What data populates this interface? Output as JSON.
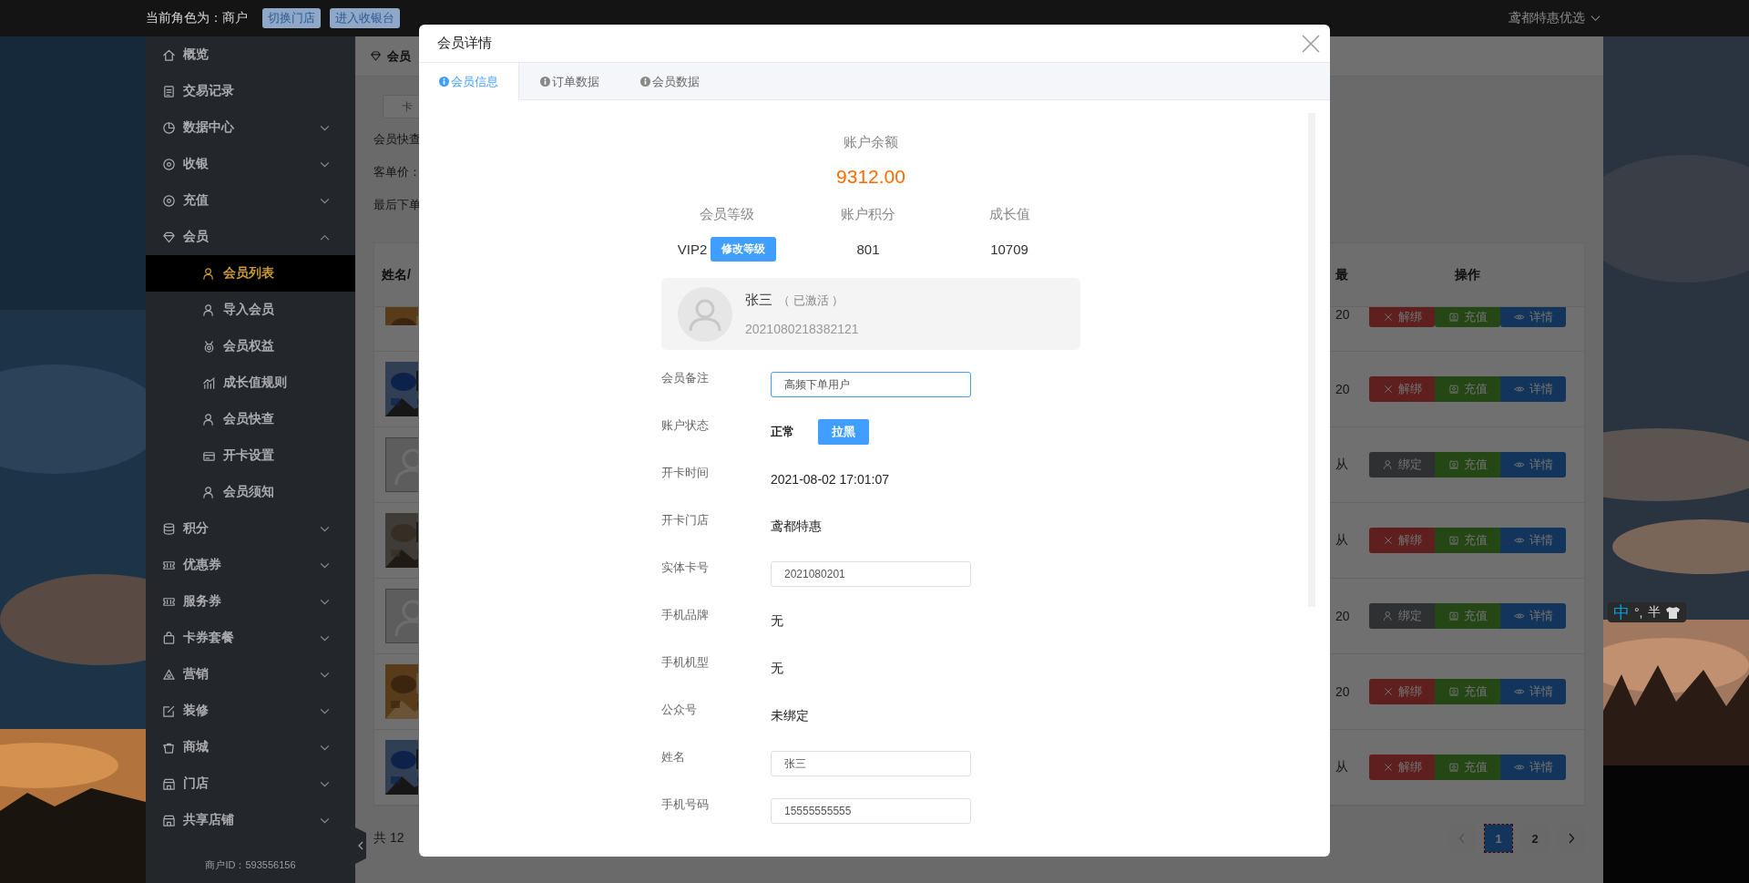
{
  "top_bar": {
    "role": "当前角色为：商户",
    "buttons": [
      {
        "label": "切换门店"
      },
      {
        "label": "进入收银台"
      }
    ],
    "store": "鸢都特惠优选"
  },
  "sidebar": {
    "items": [
      {
        "label": "概览",
        "selected": false
      },
      {
        "label": "交易记录",
        "selected": false
      },
      {
        "label": "数据中心",
        "selected": false,
        "expanded": false
      },
      {
        "label": "收银",
        "selected": false,
        "expanded": false
      },
      {
        "label": "充值",
        "selected": false,
        "expanded": false
      },
      {
        "label": "会员",
        "selected": false,
        "expanded": true,
        "children": [
          {
            "label": "会员列表",
            "selected": true
          },
          {
            "label": "导入会员",
            "selected": false
          },
          {
            "label": "会员权益",
            "selected": false
          },
          {
            "label": "成长值规则",
            "selected": false
          },
          {
            "label": "会员快查",
            "selected": false
          },
          {
            "label": "开卡设置",
            "selected": false
          },
          {
            "label": "会员须知",
            "selected": false
          }
        ]
      },
      {
        "label": "积分",
        "selected": false,
        "expanded": false
      },
      {
        "label": "优惠券",
        "selected": false,
        "expanded": false
      },
      {
        "label": "服务券",
        "selected": false,
        "expanded": false
      },
      {
        "label": "卡券套餐",
        "selected": false,
        "expanded": false
      },
      {
        "label": "营销",
        "selected": false,
        "expanded": false
      },
      {
        "label": "装修",
        "selected": false,
        "expanded": false
      },
      {
        "label": "商城",
        "selected": false,
        "expanded": false
      },
      {
        "label": "门店",
        "selected": false,
        "expanded": false
      },
      {
        "label": "共享店铺",
        "selected": false,
        "expanded": false
      }
    ],
    "merchant_id": "商户ID：593556156"
  },
  "content": {
    "breadcrumb": "会员",
    "search_placeholder": "卡",
    "quick_lookup": "会员快查",
    "avg_order": "客单价：",
    "last_order": "最后下单",
    "table": {
      "columns": [
        {
          "label": "姓名/"
        },
        {
          "label": "最"
        },
        {
          "label": "操作"
        }
      ],
      "rows": [
        {
          "cell": "20",
          "actions": [
            {
              "kind": "unbind",
              "label": "解绑"
            },
            {
              "kind": "recharge",
              "label": "充值"
            },
            {
              "kind": "details",
              "label": "详情"
            }
          ]
        },
        {
          "cell": "20",
          "actions": [
            {
              "kind": "unbind",
              "label": "解绑"
            },
            {
              "kind": "recharge",
              "label": "充值"
            },
            {
              "kind": "details",
              "label": "详情"
            }
          ]
        },
        {
          "avatar": {
            "kind": "placeholder"
          },
          "cell": "从",
          "actions": [
            {
              "kind": "bind",
              "label": "绑定"
            },
            {
              "kind": "recharge",
              "label": "充值"
            },
            {
              "kind": "details",
              "label": "详情"
            }
          ]
        },
        {
          "cell": "从",
          "actions": [
            {
              "kind": "unbind",
              "label": "解绑"
            },
            {
              "kind": "recharge",
              "label": "充值"
            },
            {
              "kind": "details",
              "label": "详情"
            }
          ]
        },
        {
          "avatar": {
            "kind": "placeholder"
          },
          "cell": "20",
          "actions": [
            {
              "kind": "bind",
              "label": "绑定"
            },
            {
              "kind": "recharge",
              "label": "充值"
            },
            {
              "kind": "details",
              "label": "详情"
            }
          ]
        },
        {
          "cell": "20",
          "actions": [
            {
              "kind": "unbind",
              "label": "解绑"
            },
            {
              "kind": "recharge",
              "label": "充值"
            },
            {
              "kind": "details",
              "label": "详情"
            }
          ]
        },
        {
          "cell": "从",
          "actions": [
            {
              "kind": "unbind",
              "label": "解绑"
            },
            {
              "kind": "recharge",
              "label": "充值"
            },
            {
              "kind": "details",
              "label": "详情"
            }
          ]
        }
      ]
    },
    "pagination": {
      "total": "共 12",
      "prev": {
        "disabled": true
      },
      "pages": [
        {
          "label": "1",
          "selected": true
        },
        {
          "label": "2",
          "selected": false
        }
      ],
      "next": {
        "disabled": false
      }
    }
  },
  "modal": {
    "title": "会员详情",
    "tabs": [
      {
        "label": "会员信息",
        "selected": true
      },
      {
        "label": "订单数据",
        "selected": false
      },
      {
        "label": "会员数据",
        "selected": false
      }
    ],
    "balance": {
      "label": "账户余额",
      "value": "9312.00"
    },
    "stats": [
      {
        "label": "会员等级",
        "value": "VIP2",
        "action": "修改等级"
      },
      {
        "label": "账户积分",
        "value": "801"
      },
      {
        "label": "成长值",
        "value": "10709"
      }
    ],
    "profile": {
      "name": "张三",
      "status": "（ 已激活 ）",
      "card_id": "2021080218382121"
    },
    "fields": [
      {
        "label": "会员备注",
        "kind": "input",
        "value": "高频下单用户",
        "focused": true
      },
      {
        "label": "账户状态",
        "kind": "status",
        "value": "正常",
        "action": "拉黑"
      },
      {
        "label": "开卡时间",
        "kind": "text",
        "value": "2021-08-02 17:01:07"
      },
      {
        "label": "开卡门店",
        "kind": "text",
        "value": "鸢都特惠"
      },
      {
        "label": "实体卡号",
        "kind": "input",
        "value": "2021080201",
        "focused": false
      },
      {
        "label": "手机品牌",
        "kind": "text",
        "value": "无"
      },
      {
        "label": "手机机型",
        "kind": "text",
        "value": "无"
      },
      {
        "label": "公众号",
        "kind": "text",
        "value": "未绑定"
      },
      {
        "label": "姓名",
        "kind": "input",
        "value": "张三",
        "focused": false
      },
      {
        "label": "手机号码",
        "kind": "input",
        "value": "15555555555",
        "focused": false
      }
    ]
  },
  "ime": {
    "mode": "中",
    "punct": "°,",
    "width": "半"
  }
}
